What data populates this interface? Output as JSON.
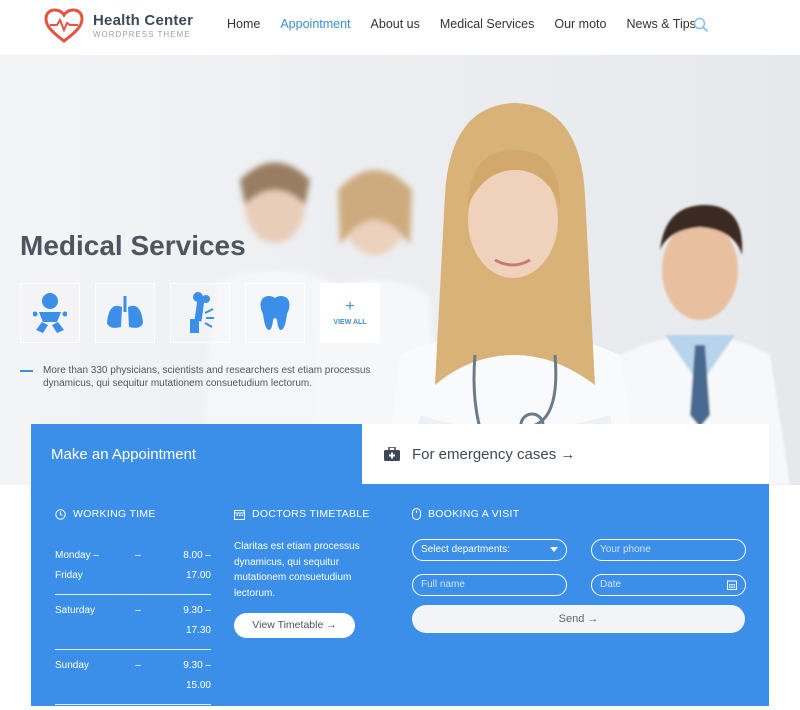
{
  "brand": {
    "title": "Health Center",
    "subtitle": "WORDPRESS THEME",
    "accent": "#3b8fe8",
    "logo_color": "#e2553e"
  },
  "nav": {
    "items": [
      "Home",
      "Appointment",
      "About us",
      "Medical Services",
      "Our moto",
      "News & Tips"
    ],
    "active": "Appointment",
    "search_icon": "search-icon"
  },
  "hero": {
    "title": "Medical Services",
    "services": [
      {
        "icon": "baby-icon"
      },
      {
        "icon": "lungs-icon"
      },
      {
        "icon": "bone-icon"
      },
      {
        "icon": "tooth-icon"
      }
    ],
    "view_all_symbol": "+",
    "view_all_label": "VIEW ALL",
    "description": "More than 330 physicians, scientists and researchers est etiam processus dynamicus, qui sequitur mutationem consuetudium lectorum."
  },
  "appointment": {
    "tab_label": "Make an Appointment",
    "emergency_label": "For emergency cases →",
    "working_time": {
      "heading": "WORKING TIME",
      "rows": [
        {
          "day": "Monday – Friday",
          "dash": "–",
          "time": "8.00 – 17.00"
        },
        {
          "day": "Saturday",
          "dash": "–",
          "time": "9.30 – 17.30"
        },
        {
          "day": "Sunday",
          "dash": "–",
          "time": "9.30 – 15.00"
        }
      ]
    },
    "timetable": {
      "heading": "DOCTORS TIMETABLE",
      "text": "Claritas est etiam processus dynamicus, qui sequitur mutationem consuetudium lectorum.",
      "button": "View Timetable →"
    },
    "booking": {
      "heading": "BOOKING A VISIT",
      "department_value": "Select departments:",
      "phone_placeholder": "Your phone",
      "name_placeholder": "Full name",
      "date_placeholder": "Date",
      "send_label": "Send →"
    }
  }
}
